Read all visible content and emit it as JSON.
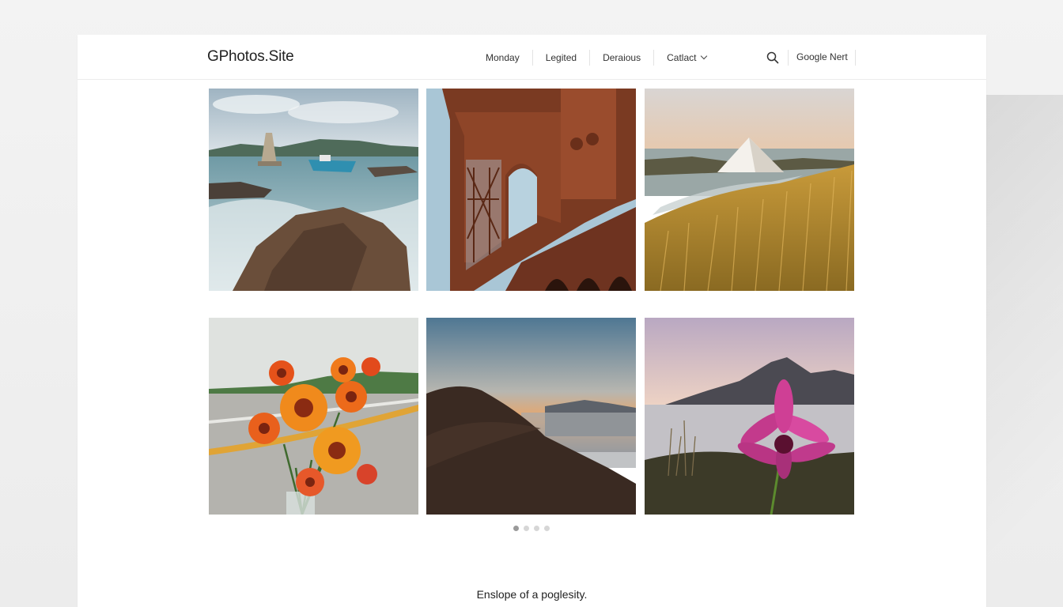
{
  "site": {
    "logo": "GPhotos.Site"
  },
  "nav": {
    "items": [
      {
        "label": "Monday"
      },
      {
        "label": "Legited"
      },
      {
        "label": "Deraious"
      },
      {
        "label": "Catlact",
        "has_dropdown": true
      }
    ],
    "search_icon": "search-icon",
    "secondary_link": "Google Nert"
  },
  "gallery": {
    "photos": [
      {
        "subject": "rocky-coast-with-boat"
      },
      {
        "subject": "ornate-red-arch-bridge"
      },
      {
        "subject": "golden-grass-and-white-pyramid"
      },
      {
        "subject": "orange-gerbera-bouquet"
      },
      {
        "subject": "desert-dune-at-dusk"
      },
      {
        "subject": "pink-flower-by-mountain-lake"
      }
    ]
  },
  "pagination": {
    "count": 4,
    "active_index": 0
  },
  "footer": {
    "caption": "Enslope of a poglesity."
  },
  "colors": {
    "page_background": "#efefef",
    "sheet_background": "#ffffff",
    "text": "#222222",
    "dot_active": "#9a9a9a",
    "dot_inactive": "#d6d6d6"
  }
}
